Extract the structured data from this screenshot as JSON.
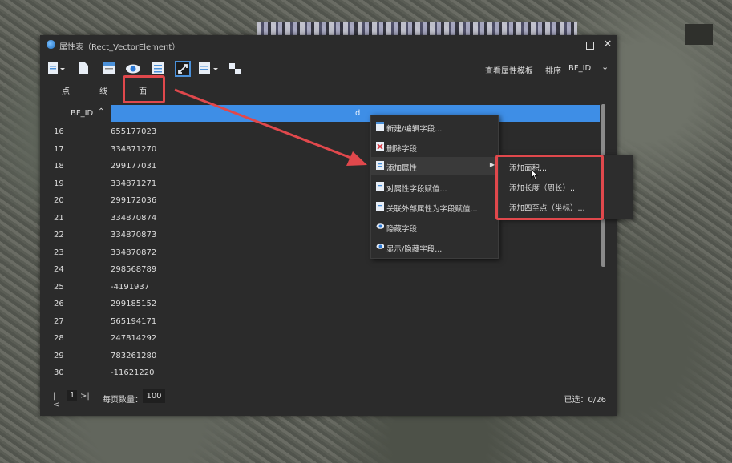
{
  "window": {
    "title": "属性表（Rect_VectorElement）"
  },
  "toolbar": {
    "template_label": "查看属性模板",
    "sort_label": "排序",
    "sort_value": "BF_ID"
  },
  "tabs": [
    {
      "label": "点"
    },
    {
      "label": "线"
    },
    {
      "label": "面"
    }
  ],
  "table": {
    "columns": [
      "BF_ID",
      "Id"
    ],
    "rows": [
      {
        "bf_id": "16",
        "id": "655177023"
      },
      {
        "bf_id": "17",
        "id": "334871270"
      },
      {
        "bf_id": "18",
        "id": "299177031"
      },
      {
        "bf_id": "19",
        "id": "334871271"
      },
      {
        "bf_id": "20",
        "id": "299172036"
      },
      {
        "bf_id": "21",
        "id": "334870874"
      },
      {
        "bf_id": "22",
        "id": "334870873"
      },
      {
        "bf_id": "23",
        "id": "334870872"
      },
      {
        "bf_id": "24",
        "id": "298568789"
      },
      {
        "bf_id": "25",
        "id": "-4191937"
      },
      {
        "bf_id": "26",
        "id": "299185152"
      },
      {
        "bf_id": "27",
        "id": "565194171"
      },
      {
        "bf_id": "28",
        "id": "247814292"
      },
      {
        "bf_id": "29",
        "id": "783261280"
      },
      {
        "bf_id": "30",
        "id": "-11621220"
      }
    ]
  },
  "context_menu": {
    "items": [
      {
        "label": "新建/编辑字段..."
      },
      {
        "label": "删除字段"
      },
      {
        "label": "添加属性"
      },
      {
        "label": "对属性字段赋值..."
      },
      {
        "label": "关联外部属性为字段赋值..."
      },
      {
        "label": "隐藏字段"
      },
      {
        "label": "显示/隐藏字段..."
      }
    ]
  },
  "sub_menu": {
    "items": [
      {
        "label": "添加面积..."
      },
      {
        "label": "添加长度（周长）..."
      },
      {
        "label": "添加四至点（坐标）..."
      }
    ]
  },
  "footer": {
    "page": "1",
    "page_size_label": "每页数量：",
    "page_size": "100",
    "selected": "已选：0/26"
  },
  "colors": {
    "window_bg": "#2b2b2b",
    "header_accent": "#3e8ee6",
    "highlight": "#e0484c"
  }
}
